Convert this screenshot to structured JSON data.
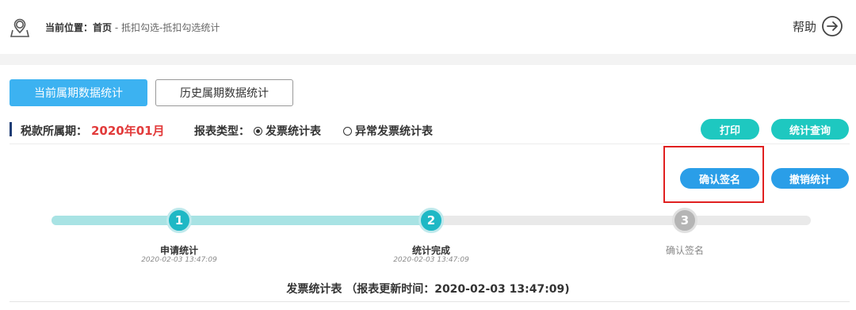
{
  "breadcrumb": {
    "prefix": "当前位置：",
    "home": "首页",
    "path": " - 抵扣勾选-抵扣勾选统计"
  },
  "help": {
    "label": "帮助"
  },
  "tabs": [
    {
      "label": "当前属期数据统计",
      "active": true
    },
    {
      "label": "历史属期数据统计",
      "active": false
    }
  ],
  "filter": {
    "period_label": "税款所属期：",
    "period_value": "2020年01月",
    "type_label": "报表类型：",
    "options": [
      {
        "label": "发票统计表",
        "selected": true
      },
      {
        "label": "异常发票统计表",
        "selected": false
      }
    ]
  },
  "actions": {
    "print": "打印",
    "query": "统计查询",
    "confirm": "确认签名",
    "revoke": "撤销统计"
  },
  "steps": [
    {
      "number": "1",
      "title": "申请统计",
      "time": "2020-02-03 13:47:09",
      "done": true
    },
    {
      "number": "2",
      "title": "统计完成",
      "time": "2020-02-03 13:47:09",
      "done": true
    },
    {
      "number": "3",
      "title": "确认签名",
      "time": "",
      "done": false
    }
  ],
  "progress": {
    "completed_steps": 2,
    "total_steps": 3
  },
  "report": {
    "title": "发票统计表 （报表更新时间：2020-02-03 13:47:09)"
  },
  "colors": {
    "tab_active": "#3cb2f1",
    "pill_teal": "#1ec8c0",
    "pill_blue": "#2a9ee8",
    "period_red": "#e23b3b",
    "step_done": "#1eb8c5",
    "highlight": "#e02020"
  }
}
